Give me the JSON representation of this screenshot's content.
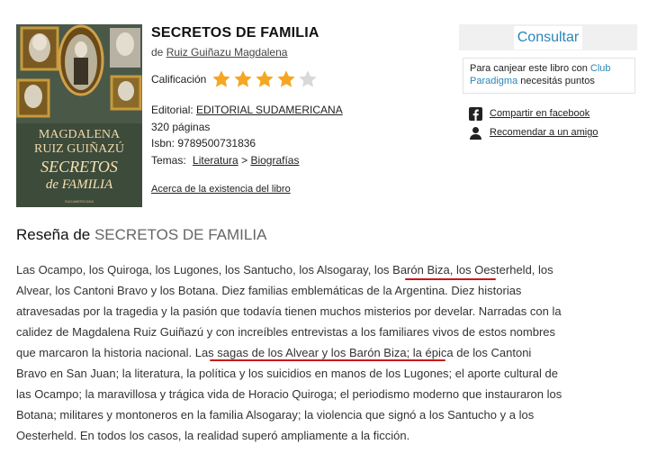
{
  "book": {
    "title": "SECRETOS DE FAMILIA",
    "author_prefix": "de",
    "author": "Ruiz Guiñazu Magdalena",
    "rating_label": "Calificación",
    "rating_stars": 4,
    "rating_max": 5,
    "editorial_label": "Editorial:",
    "editorial": "EDITORIAL SUDAMERICANA",
    "pages": "320 páginas",
    "isbn": "Isbn: 9789500731836",
    "themes_label": "Temas:",
    "theme_1": "Literatura",
    "theme_sep": ">",
    "theme_2": "Biografías",
    "existence_link": "Acerca de la existencia del libro"
  },
  "cover": {
    "author_line1": "MAGDALENA",
    "author_line2": "RUIZ GUIÑAZÚ",
    "title_line1": "SECRETOS",
    "title_line2": "de FAMILIA",
    "publisher": "SUDAMERICANA"
  },
  "sidebar": {
    "consult_label": "Consultar",
    "info_text_1": "Para canjear este libro con ",
    "info_link": "Club Paradigma",
    "info_text_2": " necesitás puntos",
    "share_facebook": "Compartir en facebook",
    "recommend_friend": "Recomendar a un amigo"
  },
  "review": {
    "heading_prefix": "Reseña de",
    "heading_title": "SECRETOS DE FAMILIA",
    "lines": [
      "Las Ocampo, los Quiroga, los Lugones, los Santucho, los Alsogaray, los Barón Biza, los Oesterheld, los",
      "Alvear, los Cantoni Bravo y los Botana. Diez familias emblemáticas de la Argentina. Diez historias",
      "atravesadas por la tragedia y la pasión que todavía tienen muchos misterios por develar. Narradas con la",
      "calidez de Magdalena Ruiz Guiñazú y con increíbles entrevistas a los familiares vivos de estos nombres",
      "que marcaron la historia nacional. Las sagas de los Alvear y los Barón Biza; la épica de los Cantoni",
      "Bravo en San Juan; la literatura, la política y los suicidios en manos de los Lugones; el aporte cultural de",
      "las Ocampo; la maravillosa y trágica vida de Horacio Quiroga; el periodismo moderno que instauraron los",
      "Botana; militares y montoneros en la familia Alsogaray; la violencia que signó a los Santucho y a los",
      "Oesterheld. En todos los casos, la realidad superó ampliamente a la ficción."
    ]
  },
  "colors": {
    "accent": "#2a86b7",
    "star_on": "#f5a623",
    "star_off": "#d9d9d9",
    "annotation": "#c8191c"
  }
}
